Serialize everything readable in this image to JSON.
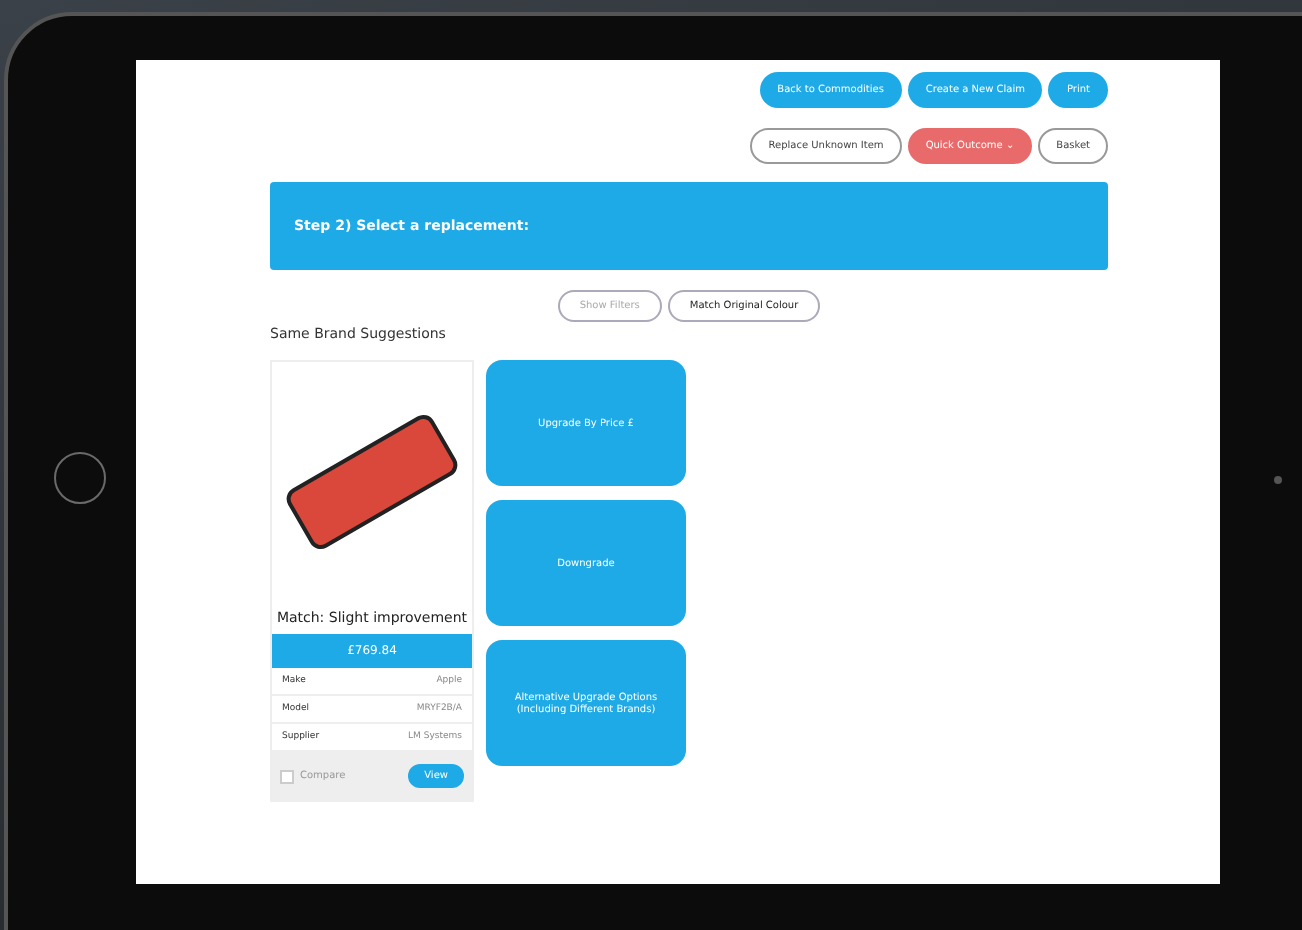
{
  "top_buttons": [
    {
      "label": "Back to Commodities",
      "kind": "primary"
    },
    {
      "label": "Create a New Claim",
      "kind": "primary"
    },
    {
      "label": "Print",
      "kind": "primary"
    }
  ],
  "action_buttons": [
    {
      "label": "Replace Unknown Item",
      "kind": "outline"
    },
    {
      "label": "Quick Outcome ⌄",
      "kind": "danger"
    },
    {
      "label": "Basket",
      "kind": "outline"
    }
  ],
  "banner": {
    "title": "Step 2) Select a replacement:"
  },
  "filters": [
    {
      "label": "Show Filters",
      "disabled": true
    },
    {
      "label": "Match Original Colour",
      "disabled": false
    }
  ],
  "section_title": "Same Brand Suggestions",
  "product": {
    "match": "Match: Slight improvement",
    "price": "£769.84",
    "specs": [
      {
        "label": "Make",
        "value": "Apple"
      },
      {
        "label": "Model",
        "value": "MRYF2B/A"
      },
      {
        "label": "Supplier",
        "value": "LM Systems"
      }
    ],
    "compare": {
      "label": "Compare",
      "checked": false
    },
    "view_button": "View"
  },
  "options": [
    "Upgrade By Price £",
    "Downgrade",
    "Alternative Upgrade Options (Including Different Brands)"
  ]
}
